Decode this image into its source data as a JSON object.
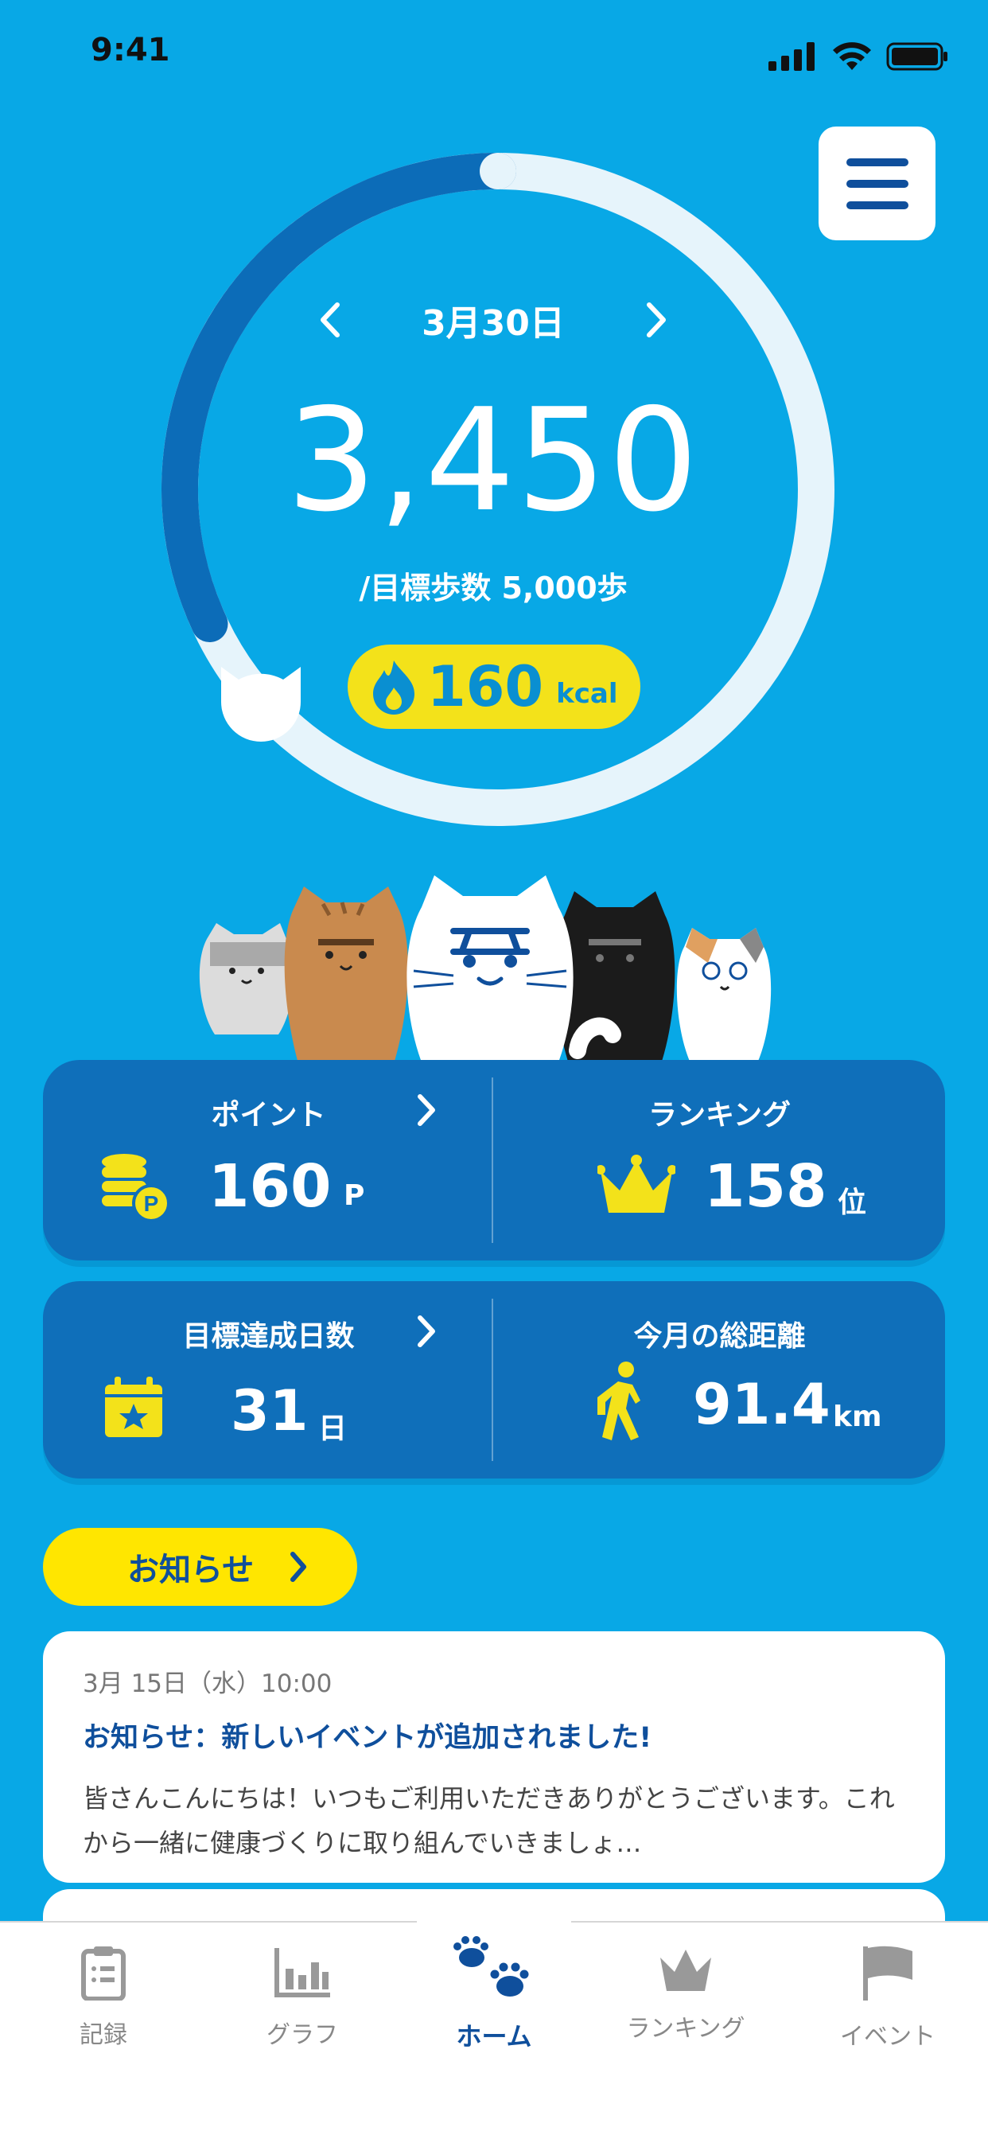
{
  "status": {
    "time": "9:41"
  },
  "date": {
    "label": "3月30日"
  },
  "steps": {
    "value": "3,450",
    "goal_label": "/目標歩数 5,000歩",
    "progress": 0.69
  },
  "calories": {
    "value": "160",
    "unit": "kcal"
  },
  "stats": {
    "points": {
      "title": "ポイント",
      "value": "160",
      "unit": "P"
    },
    "ranking": {
      "title": "ランキング",
      "value": "158",
      "unit": "位"
    },
    "goal_days": {
      "title": "目標達成日数",
      "value": "31",
      "unit": "日"
    },
    "distance": {
      "title": "今月の総距離",
      "value": "91.4",
      "unit": "km"
    }
  },
  "notice": {
    "button_label": "お知らせ",
    "items": [
      {
        "date": "3月 15日（水）10:00",
        "title": "お知らせ：新しいイベントが追加されました!",
        "body": "皆さんこんにちは！いつもご利用いただきありがとうございます。これから一緒に健康づくりに取り組んでいきましょ…"
      }
    ]
  },
  "tabs": [
    {
      "label": "記録",
      "icon": "clipboard-icon"
    },
    {
      "label": "グラフ",
      "icon": "bar-chart-icon"
    },
    {
      "label": "ホーム",
      "icon": "paw-icon"
    },
    {
      "label": "ランキング",
      "icon": "crown-icon"
    },
    {
      "label": "イベント",
      "icon": "flag-icon"
    }
  ],
  "colors": {
    "background": "#08a8e6",
    "card": "#0f6fba",
    "accent_yellow": "#ffe600",
    "navy": "#0f4f9c"
  }
}
